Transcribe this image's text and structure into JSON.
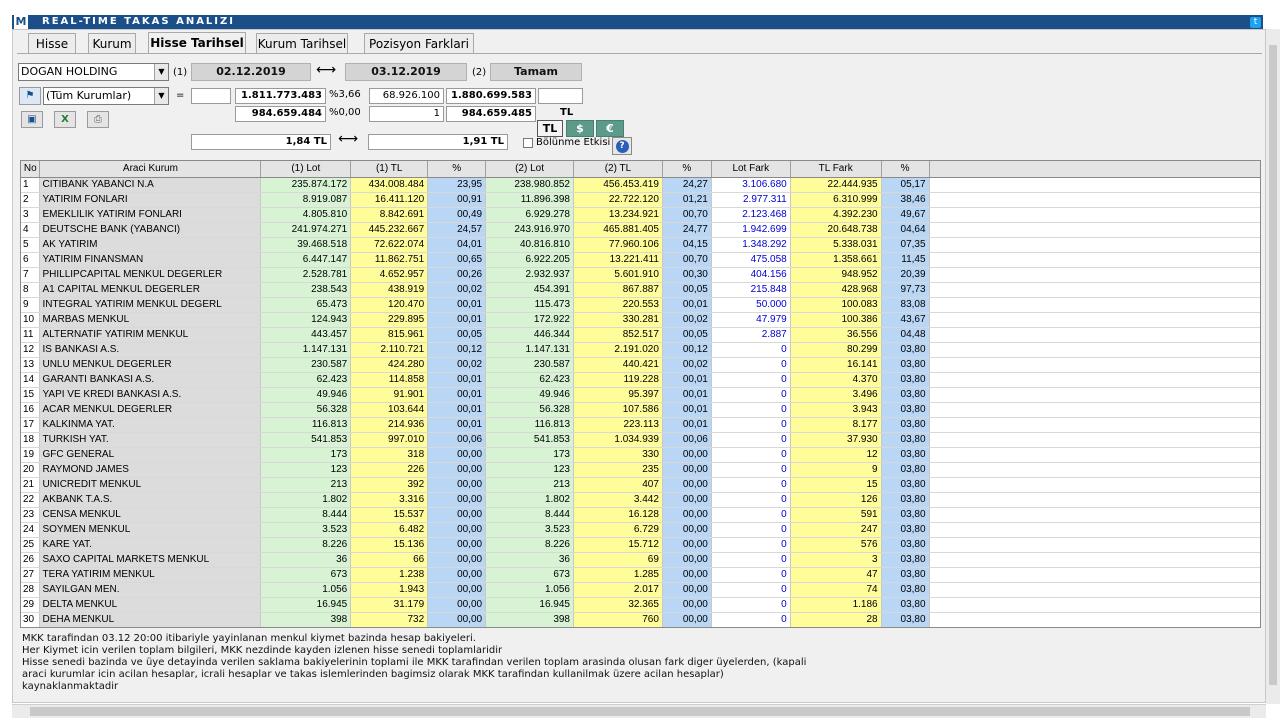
{
  "app": {
    "title": "REAL-TIME TAKAS ANALIZI",
    "logo": "M"
  },
  "tabs": [
    {
      "label": "Hisse"
    },
    {
      "label": "Kurum"
    },
    {
      "label": "Hisse Tarihsel"
    },
    {
      "label": "Kurum Tarihsel"
    },
    {
      "label": "Pozisyon Farklari"
    }
  ],
  "controls": {
    "stock": "DOGAN HOLDING",
    "marker1": "(1)",
    "date1": "02.12.2019",
    "arrow": "⟷",
    "date2": "03.12.2019",
    "marker2": "(2)",
    "ok_button": "Tamam",
    "institution": "(Tüm Kurumlar)",
    "equals": "=",
    "row1": {
      "v1": "1.811.773.483",
      "p1": "%3,66",
      "v2": "68.926.100",
      "v3": "1.880.699.583"
    },
    "row2": {
      "v1": "984.659.484",
      "p1": "%0,00",
      "v2": "1",
      "v3": "984.659.485"
    },
    "price1": "1,84 TL",
    "price_arrow": "⟷",
    "price2": "1,91 TL",
    "currency_label": "TL",
    "currency_buttons": [
      "TL",
      "$",
      "€"
    ],
    "bolunme": "Bölünme Etkisi",
    "help": "?"
  },
  "table": {
    "headers": [
      "No",
      "Araci Kurum",
      "(1) Lot",
      "(1) TL",
      "%",
      "(2) Lot",
      "(2) TL",
      "%",
      "Lot Fark",
      "TL Fark",
      "%"
    ],
    "rows": [
      [
        "1",
        "CITIBANK YABANCI N.A",
        "235.874.172",
        "434.008.484",
        "23,95",
        "238.980.852",
        "456.453.419",
        "24,27",
        "3.106.680",
        "22.444.935",
        "05,17"
      ],
      [
        "2",
        "YATIRIM FONLARI",
        "8.919.087",
        "16.411.120",
        "00,91",
        "11.896.398",
        "22.722.120",
        "01,21",
        "2.977.311",
        "6.310.999",
        "38,46"
      ],
      [
        "3",
        "EMEKLILIK YATIRIM FONLARI",
        "4.805.810",
        "8.842.691",
        "00,49",
        "6.929.278",
        "13.234.921",
        "00,70",
        "2.123.468",
        "4.392.230",
        "49,67"
      ],
      [
        "4",
        "DEUTSCHE BANK (YABANCI)",
        "241.974.271",
        "445.232.667",
        "24,57",
        "243.916.970",
        "465.881.405",
        "24,77",
        "1.942.699",
        "20.648.738",
        "04,64"
      ],
      [
        "5",
        "AK YATIRIM",
        "39.468.518",
        "72.622.074",
        "04,01",
        "40.816.810",
        "77.960.106",
        "04,15",
        "1.348.292",
        "5.338.031",
        "07,35"
      ],
      [
        "6",
        "YATIRIM FINANSMAN",
        "6.447.147",
        "11.862.751",
        "00,65",
        "6.922.205",
        "13.221.411",
        "00,70",
        "475.058",
        "1.358.661",
        "11,45"
      ],
      [
        "7",
        "PHILLIPCAPITAL MENKUL DEGERLER",
        "2.528.781",
        "4.652.957",
        "00,26",
        "2.932.937",
        "5.601.910",
        "00,30",
        "404.156",
        "948.952",
        "20,39"
      ],
      [
        "8",
        "A1 CAPITAL MENKUL DEGERLER",
        "238.543",
        "438.919",
        "00,02",
        "454.391",
        "867.887",
        "00,05",
        "215.848",
        "428.968",
        "97,73"
      ],
      [
        "9",
        "INTEGRAL YATIRIM MENKUL DEGERL",
        "65.473",
        "120.470",
        "00,01",
        "115.473",
        "220.553",
        "00,01",
        "50.000",
        "100.083",
        "83,08"
      ],
      [
        "10",
        "MARBAS MENKUL",
        "124.943",
        "229.895",
        "00,01",
        "172.922",
        "330.281",
        "00,02",
        "47.979",
        "100.386",
        "43,67"
      ],
      [
        "11",
        "ALTERNATIF YATIRIM MENKUL",
        "443.457",
        "815.961",
        "00,05",
        "446.344",
        "852.517",
        "00,05",
        "2.887",
        "36.556",
        "04,48"
      ],
      [
        "12",
        "IS BANKASI A.S.",
        "1.147.131",
        "2.110.721",
        "00,12",
        "1.147.131",
        "2.191.020",
        "00,12",
        "0",
        "80.299",
        "03,80"
      ],
      [
        "13",
        "UNLU MENKUL DEGERLER",
        "230.587",
        "424.280",
        "00,02",
        "230.587",
        "440.421",
        "00,02",
        "0",
        "16.141",
        "03,80"
      ],
      [
        "14",
        "GARANTI BANKASI A.S.",
        "62.423",
        "114.858",
        "00,01",
        "62.423",
        "119.228",
        "00,01",
        "0",
        "4.370",
        "03,80"
      ],
      [
        "15",
        "YAPI VE KREDI BANKASI A.S.",
        "49.946",
        "91.901",
        "00,01",
        "49.946",
        "95.397",
        "00,01",
        "0",
        "3.496",
        "03,80"
      ],
      [
        "16",
        "ACAR MENKUL DEGERLER",
        "56.328",
        "103.644",
        "00,01",
        "56.328",
        "107.586",
        "00,01",
        "0",
        "3.943",
        "03,80"
      ],
      [
        "17",
        "KALKINMA YAT.",
        "116.813",
        "214.936",
        "00,01",
        "116.813",
        "223.113",
        "00,01",
        "0",
        "8.177",
        "03,80"
      ],
      [
        "18",
        "TURKISH YAT.",
        "541.853",
        "997.010",
        "00,06",
        "541.853",
        "1.034.939",
        "00,06",
        "0",
        "37.930",
        "03,80"
      ],
      [
        "19",
        "GFC GENERAL",
        "173",
        "318",
        "00,00",
        "173",
        "330",
        "00,00",
        "0",
        "12",
        "03,80"
      ],
      [
        "20",
        "RAYMOND JAMES",
        "123",
        "226",
        "00,00",
        "123",
        "235",
        "00,00",
        "0",
        "9",
        "03,80"
      ],
      [
        "21",
        "UNICREDIT MENKUL",
        "213",
        "392",
        "00,00",
        "213",
        "407",
        "00,00",
        "0",
        "15",
        "03,80"
      ],
      [
        "22",
        "AKBANK T.A.S.",
        "1.802",
        "3.316",
        "00,00",
        "1.802",
        "3.442",
        "00,00",
        "0",
        "126",
        "03,80"
      ],
      [
        "23",
        "CENSA MENKUL",
        "8.444",
        "15.537",
        "00,00",
        "8.444",
        "16.128",
        "00,00",
        "0",
        "591",
        "03,80"
      ],
      [
        "24",
        "SOYMEN MENKUL",
        "3.523",
        "6.482",
        "00,00",
        "3.523",
        "6.729",
        "00,00",
        "0",
        "247",
        "03,80"
      ],
      [
        "25",
        "KARE YAT.",
        "8.226",
        "15.136",
        "00,00",
        "8.226",
        "15.712",
        "00,00",
        "0",
        "576",
        "03,80"
      ],
      [
        "26",
        "SAXO CAPITAL MARKETS MENKUL",
        "36",
        "66",
        "00,00",
        "36",
        "69",
        "00,00",
        "0",
        "3",
        "03,80"
      ],
      [
        "27",
        "TERA YATIRIM MENKUL",
        "673",
        "1.238",
        "00,00",
        "673",
        "1.285",
        "00,00",
        "0",
        "47",
        "03,80"
      ],
      [
        "28",
        "SAYILGAN MEN.",
        "1.056",
        "1.943",
        "00,00",
        "1.056",
        "2.017",
        "00,00",
        "0",
        "74",
        "03,80"
      ],
      [
        "29",
        "DELTA MENKUL",
        "16.945",
        "31.179",
        "00,00",
        "16.945",
        "32.365",
        "00,00",
        "0",
        "1.186",
        "03,80"
      ],
      [
        "30",
        "DEHA MENKUL",
        "398",
        "732",
        "00,00",
        "398",
        "760",
        "00,00",
        "0",
        "28",
        "03,80"
      ]
    ]
  },
  "footer": {
    "line1": "MKK tarafindan 03.12 20:00 itibariyle yayinlanan menkul kiymet bazinda hesap bakiyeleri.",
    "line2": "Her Kiymet icin verilen toplam bilgileri, MKK nezdinde kayden izlenen hisse senedi toplamlaridir",
    "line3": "Hisse senedi bazinda ve üye detayinda verilen saklama bakiyelerinin toplami ile MKK tarafindan verilen toplam arasinda olusan fark diger üyelerden, (kapali",
    "line4": "araci kurumlar icin acilan hesaplar, icrali hesaplar ve takas islemlerinden bagimsiz olarak MKK tarafindan kullanilmak üzere acilan hesaplar)",
    "line5": "kaynaklanmaktadir"
  },
  "icons": [
    "logo-icon",
    "twitter-icon",
    "institution-icon",
    "save-icon",
    "excel-icon",
    "print-icon",
    "help-icon"
  ],
  "colors": {
    "titlebar": "#1a4f8a",
    "lot_green": "#d7f3d4",
    "tl_yellow": "#fffc9a",
    "pct_blue": "#b9d7f5",
    "fark_blue_text": "#0000d0",
    "currency_button": "#5c9a8a"
  }
}
